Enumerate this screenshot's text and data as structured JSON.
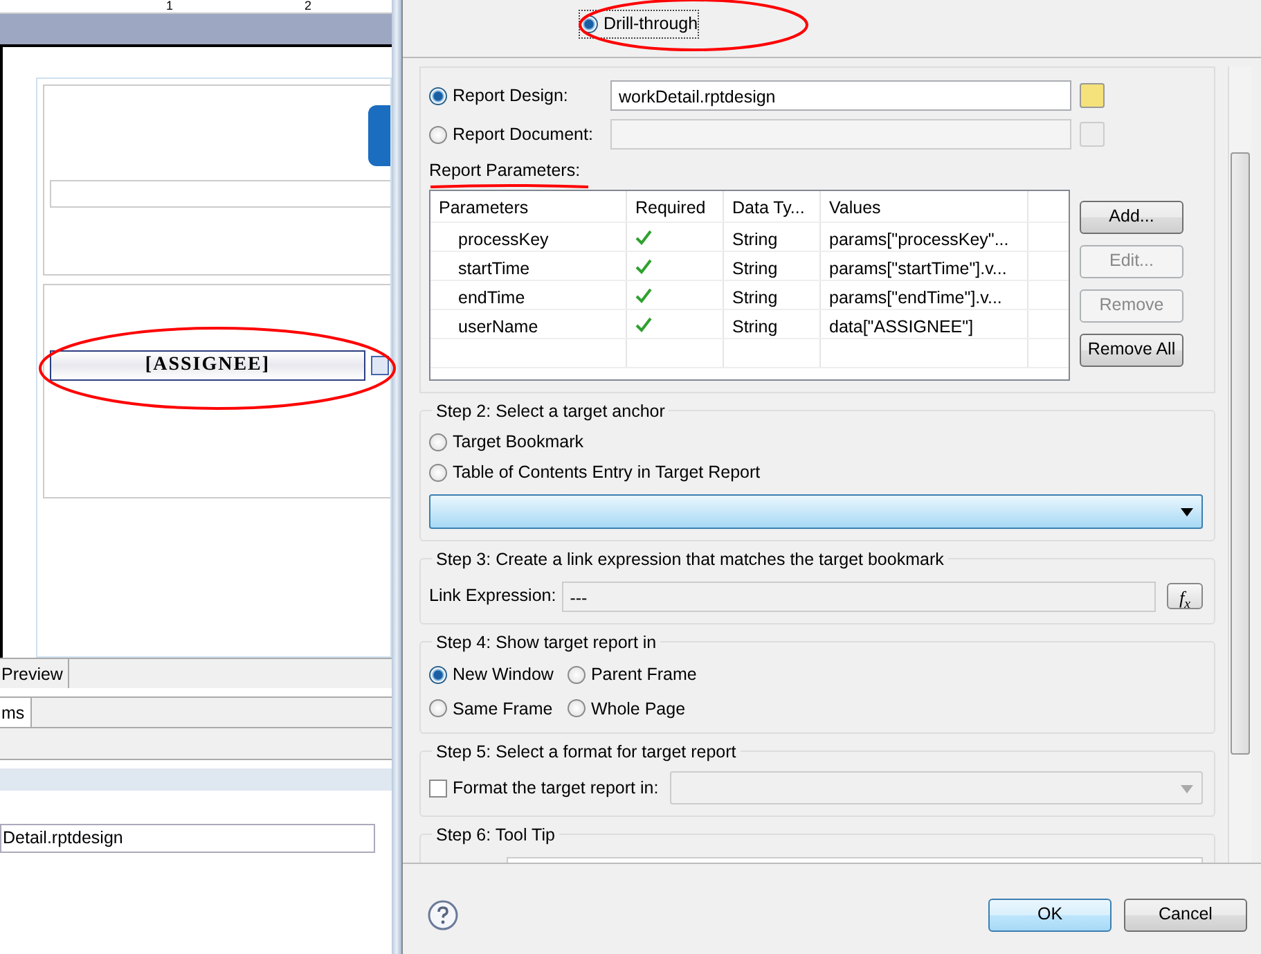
{
  "editor": {
    "ruler_labels": [
      "1",
      "2"
    ],
    "data_item": "[ASSIGNEE]",
    "tabs": [
      {
        "label": "Preview",
        "selected": false
      }
    ],
    "bottom_tabs": [
      {
        "label": "ms",
        "selected": true
      }
    ],
    "file_field": "Detail.rptdesign"
  },
  "dialog": {
    "link_type": {
      "label": "Drill-through",
      "selected": true
    },
    "targets": [
      {
        "label": "Report Design:",
        "selected": true,
        "value": "workDetail.rptdesign",
        "disabled": false
      },
      {
        "label": "Report Document:",
        "selected": false,
        "disabled": true
      }
    ],
    "parameters_label": "Report Parameters:",
    "table": {
      "columns": [
        "Parameters",
        "Required",
        "Data Ty...",
        "Values"
      ],
      "rows": [
        {
          "name": "processKey",
          "required": true,
          "type": "String",
          "value": "params[\"processKey\"..."
        },
        {
          "name": "startTime",
          "required": true,
          "type": "String",
          "value": "params[\"startTime\"].v..."
        },
        {
          "name": "endTime",
          "required": true,
          "type": "String",
          "value": "params[\"endTime\"].v..."
        },
        {
          "name": "userName",
          "required": true,
          "type": "String",
          "value": "data[\"ASSIGNEE\"]"
        }
      ]
    },
    "table_buttons": [
      {
        "label": "Add...",
        "disabled": false
      },
      {
        "label": "Edit...",
        "disabled": true
      },
      {
        "label": "Remove",
        "disabled": true
      },
      {
        "label": "Remove All",
        "disabled": false
      }
    ],
    "steps": [
      {
        "kind": "anchor",
        "title": "Step 2: Select a target anchor",
        "options": [
          {
            "label": "Target Bookmark",
            "selected": false
          },
          {
            "label": "Table of Contents Entry in Target Report",
            "selected": false
          }
        ]
      },
      {
        "kind": "expression",
        "title": "Step 3: Create a link expression that matches the target bookmark",
        "label": "Link Expression:",
        "value": "---",
        "button": "*f*$_{x}$"
      },
      {
        "kind": "radios",
        "title": "Step 4: Show target report in",
        "options": [
          {
            "label": "New Window",
            "selected": true
          },
          {
            "label": "Parent Frame",
            "selected": false
          },
          {
            "label": "Same Frame",
            "selected": false
          },
          {
            "label": "Whole Page",
            "selected": false
          }
        ]
      },
      {
        "kind": "format",
        "title": "Step 5: Select a format for target report",
        "label": "Format the target report in:",
        "checked": false
      },
      {
        "kind": "tooltip",
        "title": "Step 6: Tool Tip"
      }
    ],
    "buttons": [
      {
        "label": "OK",
        "default": true
      },
      {
        "label": "Cancel",
        "default": false
      }
    ]
  }
}
